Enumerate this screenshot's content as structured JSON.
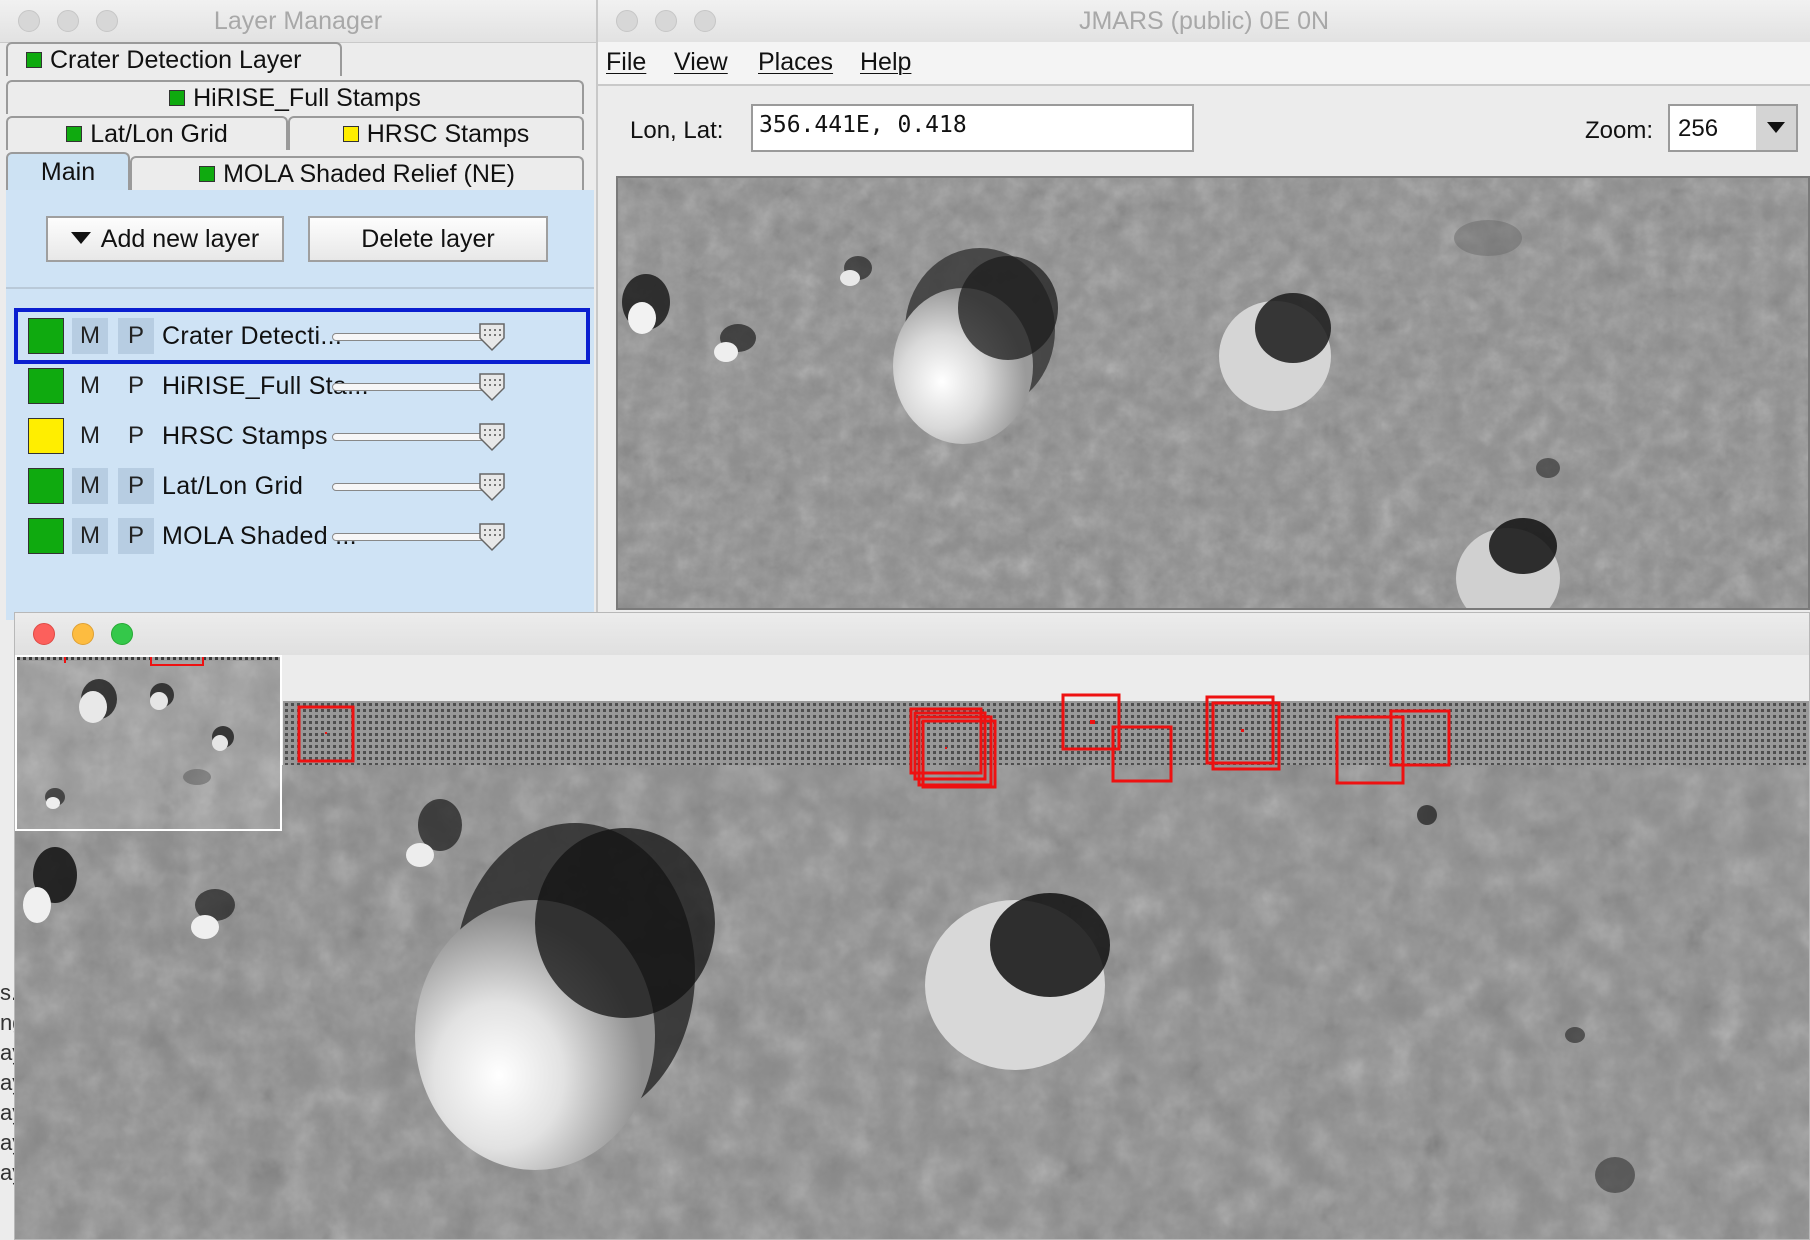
{
  "layer_manager": {
    "title": "Layer Manager",
    "tabs": [
      {
        "label": "Crater Detection Layer",
        "color": "#0faa0f"
      },
      {
        "label": "HiRISE_Full Stamps",
        "color": "#0faa0f"
      },
      {
        "label": "Lat/Lon Grid",
        "color": "#0faa0f"
      },
      {
        "label": "HRSC Stamps",
        "color": "#ffee00"
      },
      {
        "label": "Main"
      },
      {
        "label": "MOLA Shaded Relief (NE)",
        "color": "#0faa0f"
      }
    ],
    "add_layer_label": "Add new layer",
    "delete_layer_label": "Delete layer",
    "m_label": "M",
    "p_label": "P",
    "layers": [
      {
        "name": "Crater Detecti...",
        "color": "#0faa0f",
        "opacity": 1.0,
        "selected": true
      },
      {
        "name": "HiRISE_Full Sta...",
        "color": "#0faa0f",
        "opacity": 1.0
      },
      {
        "name": "HRSC Stamps",
        "color": "#ffee00",
        "opacity": 1.0
      },
      {
        "name": "Lat/Lon Grid",
        "color": "#0faa0f",
        "opacity": 1.0
      },
      {
        "name": "MOLA Shaded ...",
        "color": "#0faa0f",
        "opacity": 1.0
      }
    ]
  },
  "jmars": {
    "title": "JMARS (public) 0E 0N",
    "menu": [
      "File",
      "View",
      "Places",
      "Help"
    ],
    "lonlat_label": "Lon, Lat:",
    "lonlat_value": "356.441E, 0.418",
    "zoom_label": "Zoom:",
    "zoom_value": "256"
  },
  "left_edge_text": [
    "s.",
    "ng",
    "ay",
    "ay",
    "ay",
    "ay",
    "ay"
  ],
  "colors": {
    "selection_border": "#0a1fd0",
    "crater_box": "#ee1111",
    "panel_blue": "#cfe3f5"
  }
}
